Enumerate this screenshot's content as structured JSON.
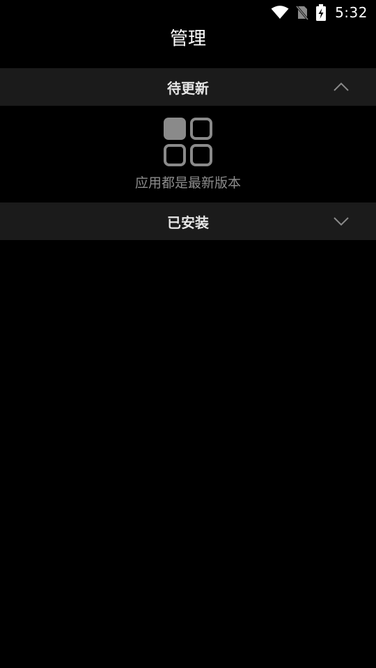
{
  "status_bar": {
    "time": "5:32",
    "icons": [
      "wifi-icon",
      "no-sim-icon",
      "battery-charging-icon"
    ]
  },
  "header": {
    "title": "管理"
  },
  "sections": [
    {
      "label": "待更新",
      "expanded": true,
      "chevron": "chevron-up-icon",
      "empty_message": "应用都是最新版本",
      "empty_icon": "apps-grid-icon"
    },
    {
      "label": "已安装",
      "expanded": false,
      "chevron": "chevron-down-icon"
    }
  ],
  "colors": {
    "background": "#000000",
    "section_bg": "#1b1b1b",
    "muted_text": "#8c8c8c",
    "icon_gray": "#8a8a8a"
  }
}
